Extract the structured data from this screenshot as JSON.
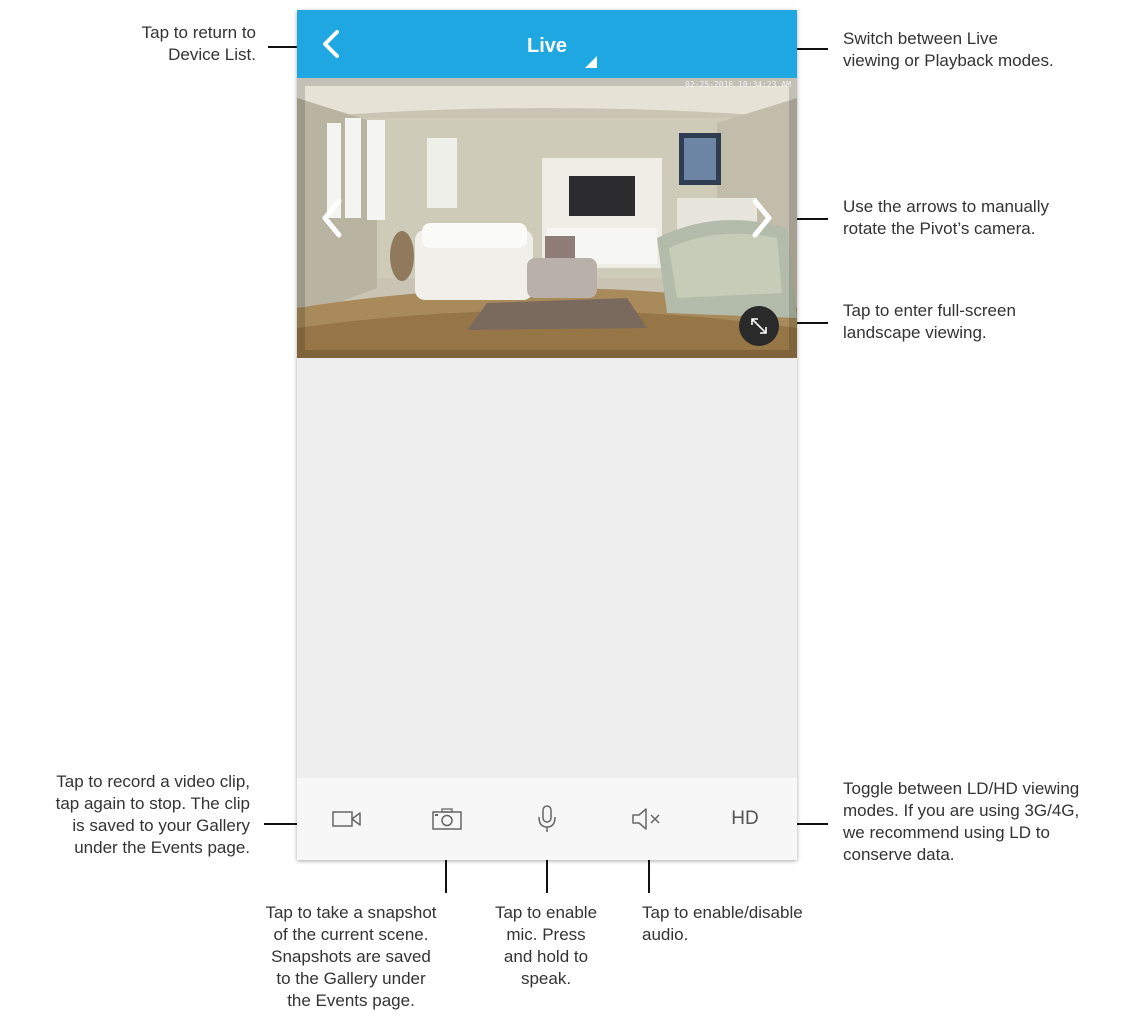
{
  "app": {
    "title": "Live",
    "timestamp": "02-25-2016 10:34:23 AM",
    "hd_label": "HD",
    "accent_color": "#1ea7e1"
  },
  "icons": {
    "back": "chevron-left-icon",
    "mode_switch": "corner-triangle-icon",
    "pan_left": "chevron-left-icon",
    "pan_right": "chevron-right-icon",
    "fullscreen": "expand-arrows-icon",
    "record": "video-camera-icon",
    "snapshot": "camera-icon",
    "mic": "microphone-icon",
    "audio": "speaker-muted-icon"
  },
  "annotations": {
    "back": "Tap to return to\nDevice List.",
    "mode": "Switch between Live\nviewing or Playback modes.",
    "arrows": "Use the arrows to manually\nrotate the Pivot’s camera.",
    "fullscreen": "Tap to enter full-screen\nlandscape viewing.",
    "record": "Tap to record a video clip,\ntap again to stop. The clip\nis saved to your Gallery\nunder the Events page.",
    "snapshot": "Tap to take a snapshot\nof the current scene.\nSnapshots are saved\nto the Gallery under\nthe Events page.",
    "mic": "Tap to enable\nmic. Press\nand hold to\nspeak.",
    "audio": "Tap to enable/disable\naudio.",
    "hd": "Toggle between LD/HD viewing\nmodes. If you are using 3G/4G,\nwe recommend using LD to\nconserve data."
  }
}
